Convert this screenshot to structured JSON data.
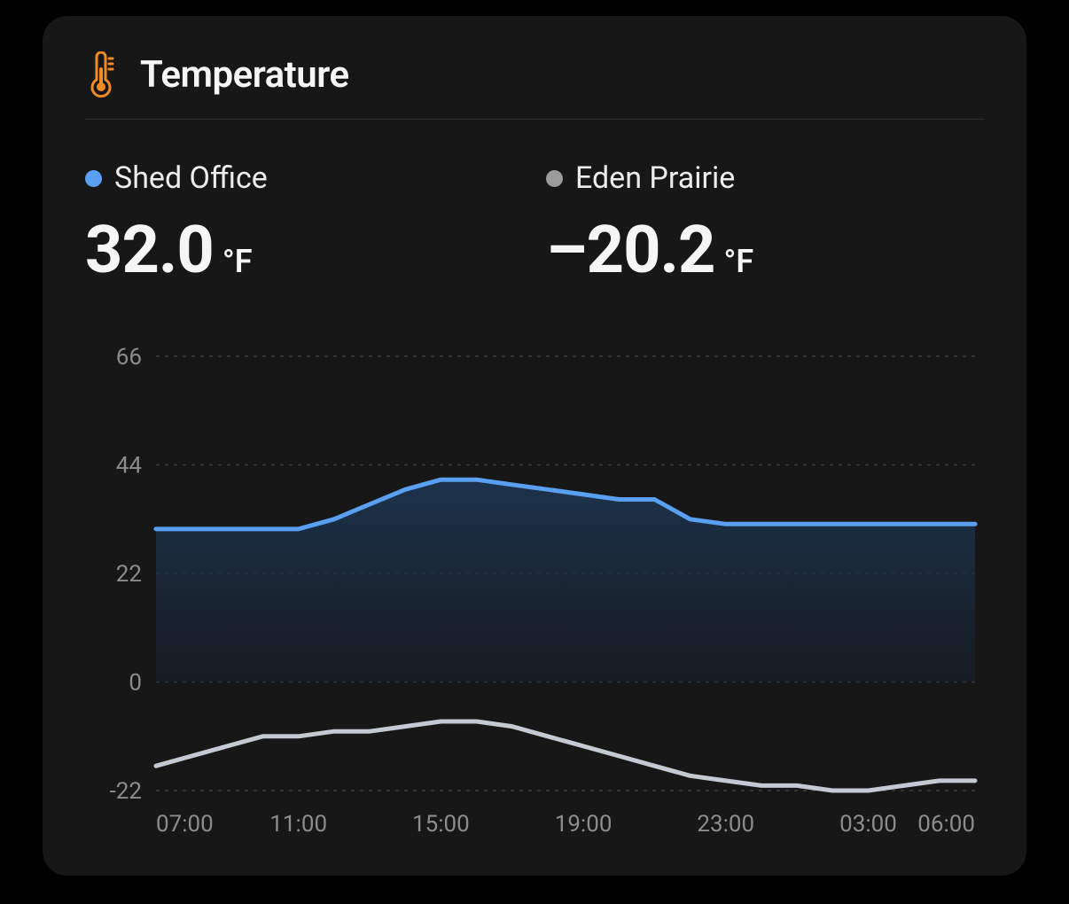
{
  "card": {
    "title": "Temperature",
    "icon": "thermometer-icon"
  },
  "readings": [
    {
      "label": "Shed Office",
      "value": "32.0",
      "unit": "°F",
      "color": "#5aa0f2"
    },
    {
      "label": "Eden Prairie",
      "value": "–20.2",
      "unit": "°F",
      "color": "#9c9c9c"
    }
  ],
  "chart_data": {
    "type": "area",
    "title": "Temperature",
    "xlabel": "",
    "ylabel": "",
    "ylim": [
      -22,
      66
    ],
    "y_ticks": [
      66,
      44,
      22,
      0,
      -22
    ],
    "x_ticks": [
      "07:00",
      "11:00",
      "15:00",
      "19:00",
      "23:00",
      "03:00",
      "06:00"
    ],
    "categories": [
      "07:00",
      "08:00",
      "09:00",
      "10:00",
      "11:00",
      "12:00",
      "13:00",
      "14:00",
      "15:00",
      "16:00",
      "17:00",
      "18:00",
      "19:00",
      "20:00",
      "21:00",
      "22:00",
      "23:00",
      "00:00",
      "01:00",
      "02:00",
      "03:00",
      "04:00",
      "05:00",
      "06:00"
    ],
    "series": [
      {
        "name": "Shed Office",
        "color": "#5aa0f2",
        "fill": true,
        "values": [
          31,
          31,
          31,
          31,
          31,
          33,
          36,
          39,
          41,
          41,
          40,
          39,
          38,
          37,
          37,
          33,
          32,
          32,
          32,
          32,
          32,
          32,
          32,
          32
        ]
      },
      {
        "name": "Eden Prairie",
        "color": "#c5c9d3",
        "fill": false,
        "values": [
          -17,
          -15,
          -13,
          -11,
          -11,
          -10,
          -10,
          -9,
          -8,
          -8,
          -9,
          -11,
          -13,
          -15,
          -17,
          -19,
          -20,
          -21,
          -21,
          -22,
          -22,
          -21,
          -20,
          -20
        ]
      }
    ]
  }
}
